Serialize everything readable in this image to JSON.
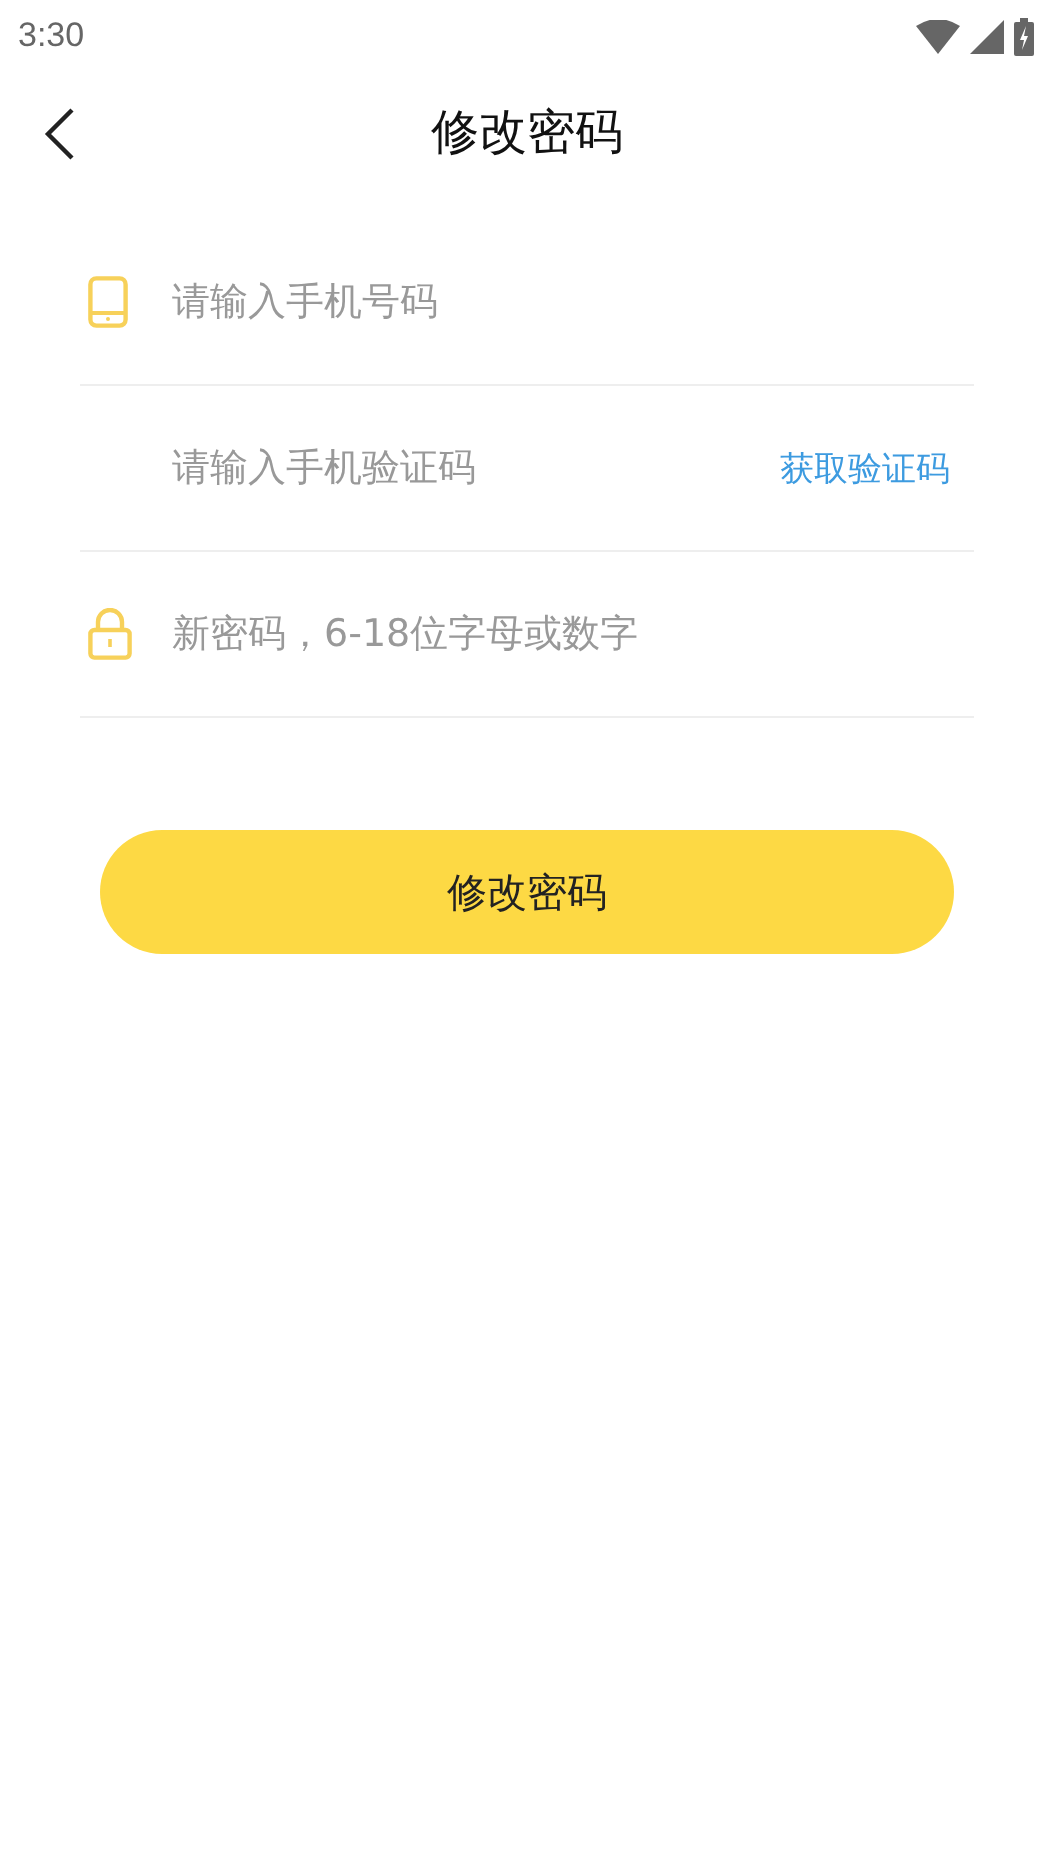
{
  "status_bar": {
    "time": "3:30"
  },
  "header": {
    "title": "修改密码"
  },
  "fields": [
    {
      "kind": "phone",
      "placeholder": "请输入手机号码"
    },
    {
      "kind": "code",
      "placeholder": "请输入手机验证码",
      "action": "获取验证码"
    },
    {
      "kind": "password",
      "placeholder": "新密码，6-18位字母或数字"
    }
  ],
  "submit": "修改密码"
}
